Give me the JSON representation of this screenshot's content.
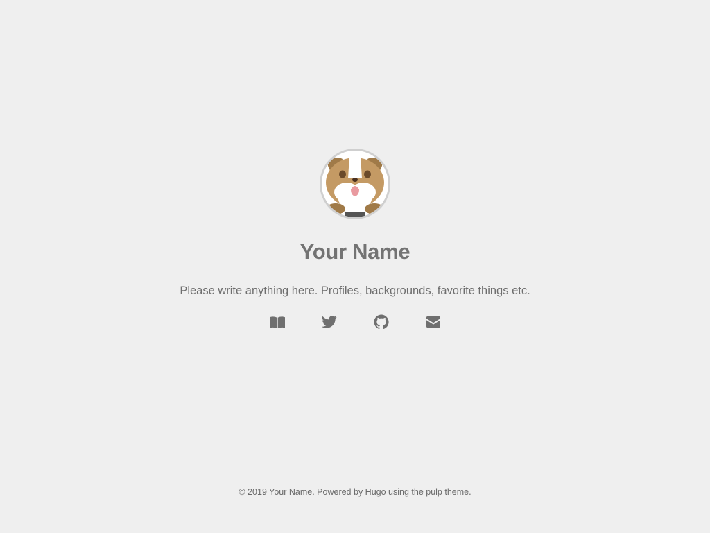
{
  "profile": {
    "avatar_icon": "bulldog-avatar-icon",
    "name": "Your Name",
    "bio": "Please write anything here. Profiles, backgrounds, favorite things etc."
  },
  "social": [
    {
      "icon": "book-icon"
    },
    {
      "icon": "twitter-icon"
    },
    {
      "icon": "github-icon"
    },
    {
      "icon": "envelope-icon"
    }
  ],
  "footer": {
    "prefix": "© 2019 Your Name. Powered by ",
    "hugo_link": "Hugo",
    "middle": " using the ",
    "theme_link": "pulp",
    "suffix": " theme."
  },
  "colors": {
    "background": "#efefef",
    "text": "#6b6b6b",
    "avatar_border": "#cfcfcf"
  }
}
